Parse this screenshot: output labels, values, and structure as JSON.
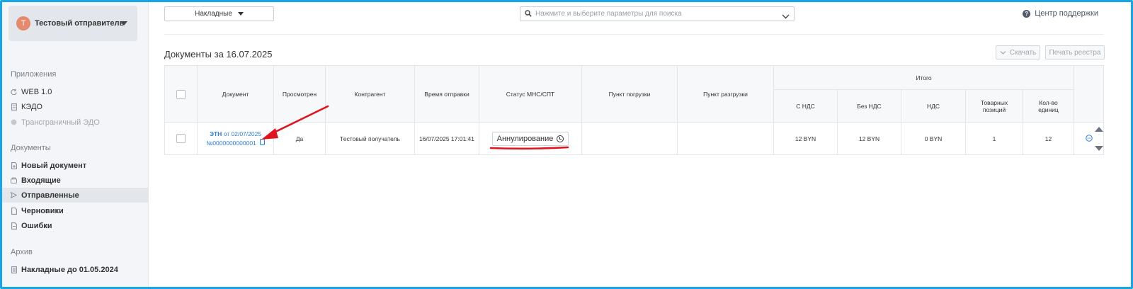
{
  "sidebar": {
    "sender": {
      "avatar_letter": "Т",
      "name": "Тестовый отправитель"
    },
    "sections": {
      "apps": "Приложения",
      "documents": "Документы",
      "archive": "Архив"
    },
    "apps": [
      {
        "label": "WEB 1.0",
        "icon": "refresh-icon"
      },
      {
        "label": "КЭДО",
        "icon": "document-icon"
      },
      {
        "label": "Трансграничный ЭДО",
        "icon": "globe-icon"
      }
    ],
    "documents": [
      {
        "label": "Новый документ",
        "icon": "new-document-icon"
      },
      {
        "label": "Входящие",
        "icon": "inbox-icon"
      },
      {
        "label": "Отправленные",
        "icon": "send-icon"
      },
      {
        "label": "Черновики",
        "icon": "draft-icon"
      },
      {
        "label": "Ошибки",
        "icon": "error-document-icon"
      }
    ],
    "archive": [
      {
        "label": "Накладные до 01.05.2024",
        "icon": "archive-icon"
      }
    ]
  },
  "topbar": {
    "doc_type": "Накладные",
    "search_placeholder": "Нажмите и выберите параметры для поиска",
    "support": "Центр поддержки"
  },
  "page": {
    "title": "Документы за 16.07.2025",
    "download": "Скачать",
    "print_register": "Печать реестра"
  },
  "table": {
    "headers": {
      "document": "Документ",
      "viewed": "Просмотрен",
      "counterparty": "Контрагент",
      "send_time": "Время отправки",
      "status": "Статус МНС/СПТ",
      "loading_point": "Пункт погрузки",
      "unloading_point": "Пункт разгрузки",
      "total": "Итого",
      "with_vat": "С НДС",
      "without_vat": "Без НДС",
      "vat": "НДС",
      "items": "Товарных позиций",
      "units": "Кол-во единиц"
    },
    "rows": [
      {
        "doc_type": "ЭТН",
        "doc_date": "от 02/07/2025",
        "doc_number": "№0000000000001",
        "viewed": "Да",
        "counterparty": "Тестовый получатель",
        "send_time": "16/07/2025 17:01:41",
        "status": "Аннулирование",
        "loading_point": "",
        "unloading_point": "",
        "with_vat": "12 BYN",
        "without_vat": "12 BYN",
        "vat": "0 BYN",
        "items": "1",
        "units": "12"
      }
    ]
  },
  "colors": {
    "frame": "#18a5e6",
    "link": "#2d7fd6",
    "annotation": "#e0141e",
    "sidebar_bg": "#f3f5f8"
  }
}
